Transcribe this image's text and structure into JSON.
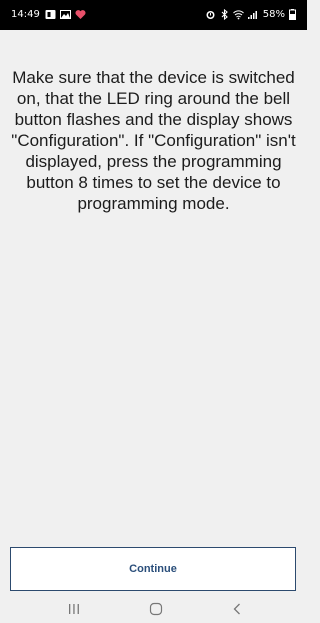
{
  "status_bar": {
    "time": "14:49",
    "battery": "58%",
    "left_icons": [
      "notification-icon",
      "gallery-icon",
      "heart-app-icon"
    ],
    "right_icons": [
      "alarm-icon",
      "bluetooth-icon",
      "wifi-icon",
      "signal-icon",
      "battery-icon"
    ]
  },
  "message": {
    "text": "Make sure that the device is switched on, that the LED ring around the bell button flashes and the display shows \"Configuration\". If \"Configuration\" isn't displayed, press the programming button 8 times to set the device to programming mode."
  },
  "continue_button": {
    "label": "Continue",
    "color": "#2a4e7a"
  },
  "nav_bar": {
    "icons": [
      "recents-icon",
      "home-icon",
      "back-icon"
    ]
  },
  "colors": {
    "background": "#f0f0f0",
    "status_bar": "#000000",
    "button_border": "#2c4a6e"
  }
}
